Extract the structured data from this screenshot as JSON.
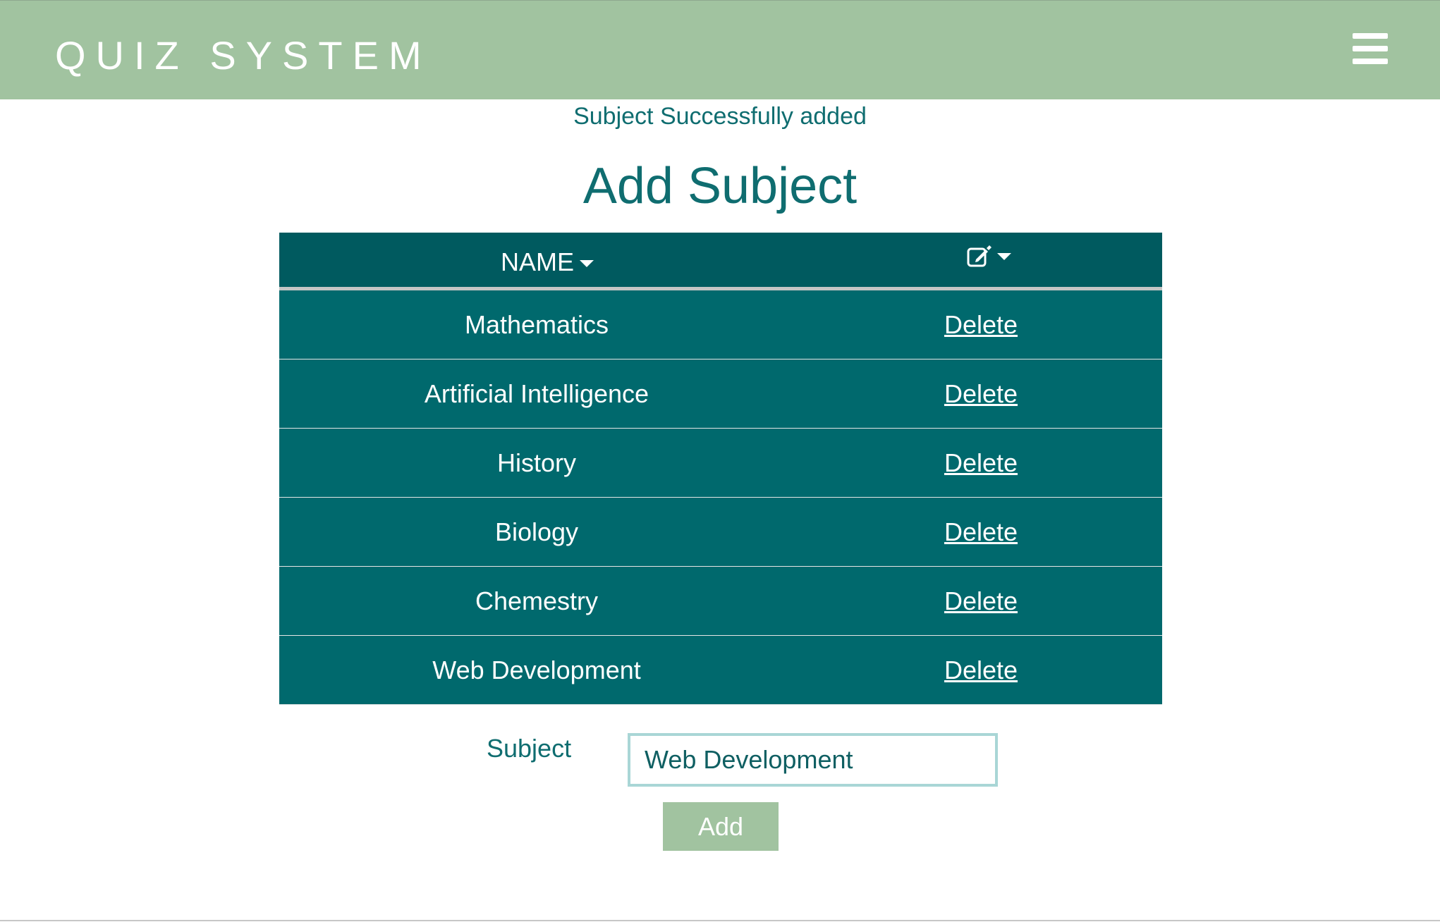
{
  "header": {
    "brand": "QUIZ SYSTEM",
    "menu_icon": "hamburger-menu-icon",
    "background_color": "#a1c3a0"
  },
  "flash_message": "Subject Successfully added",
  "page_title": "Add Subject",
  "table": {
    "header_color": "#005a5f",
    "row_color": "#00696d",
    "columns": [
      {
        "label": "NAME",
        "sort_icon": "caret-down-icon"
      },
      {
        "label": "",
        "icon": "edit-icon",
        "sort_icon": "caret-down-icon"
      }
    ],
    "rows": [
      {
        "name": "Mathematics",
        "action": "Delete"
      },
      {
        "name": "Artificial Intelligence",
        "action": "Delete"
      },
      {
        "name": "History",
        "action": "Delete"
      },
      {
        "name": "Biology",
        "action": "Delete"
      },
      {
        "name": "Chemestry",
        "action": "Delete"
      },
      {
        "name": "Web Development",
        "action": "Delete"
      }
    ]
  },
  "form": {
    "subject_label": "Subject",
    "subject_value": "Web Development",
    "submit_label": "Add"
  }
}
